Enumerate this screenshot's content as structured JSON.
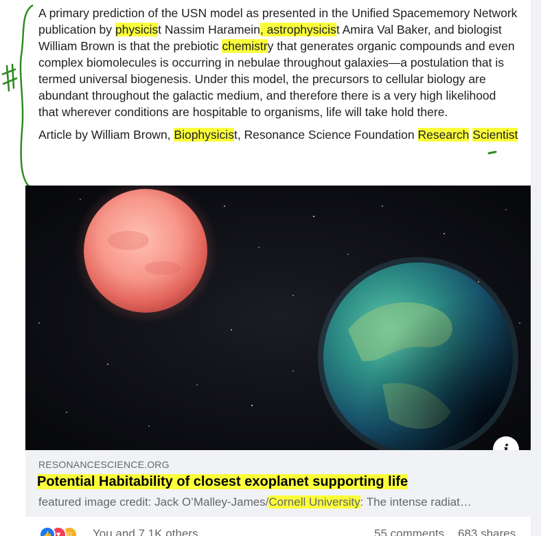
{
  "post": {
    "paragraph1": [
      {
        "t": "A primary prediction of the USN model as presented in the Unified Spacememory Network publication by ",
        "hl": false
      },
      {
        "t": "physicis",
        "hl": true
      },
      {
        "t": "t Nassim Haramein",
        "hl": false
      },
      {
        "t": ", astrophysicis",
        "hl": true
      },
      {
        "t": "t Amira Val Baker, and biologist William Brown is that the prebiotic ",
        "hl": false
      },
      {
        "t": "chemistr",
        "hl": true
      },
      {
        "t": "y that generates organic compounds and even complex biomolecules is occurring in nebulae throughout galaxies—a postulation that is termed universal biogenesis. Under this model, the precursors to cellular biology are abundant throughout the galactic medium, and therefore there is a very high likelihood that wherever conditions are hospitable to organisms, life will take hold there.",
        "hl": false
      }
    ],
    "paragraph2": [
      {
        "t": "Article by William Brown, ",
        "hl": false
      },
      {
        "t": "Biophysicis",
        "hl": true
      },
      {
        "t": "t, Resonance Science Foundation ",
        "hl": false
      },
      {
        "t": "Research",
        "hl": true
      },
      {
        "t": " ",
        "hl": false
      },
      {
        "t": "Scientist",
        "hl": true
      }
    ]
  },
  "annotation": {
    "mark": "#",
    "color": "#2f8a22"
  },
  "link_preview": {
    "domain": "RESONANCESCIENCE.ORG",
    "title": "Potential Habitability of closest exoplanet supporting life",
    "description_parts": [
      {
        "t": "featured image credit: Jack O’Malley-James/",
        "hl": false
      },
      {
        "t": "Cornell University",
        "hl": true
      },
      {
        "t": ": The intense radiat…",
        "hl": false
      }
    ],
    "info_icon": "i"
  },
  "reactions": {
    "icons": [
      "like-icon",
      "love-icon",
      "care-icon"
    ],
    "summary": "You and 7.1K others",
    "comments": "55 comments",
    "shares": "683 shares"
  },
  "colors": {
    "highlight": "#fbff3a",
    "panel": "#f0f2f5",
    "secondary_text": "#65676b"
  }
}
